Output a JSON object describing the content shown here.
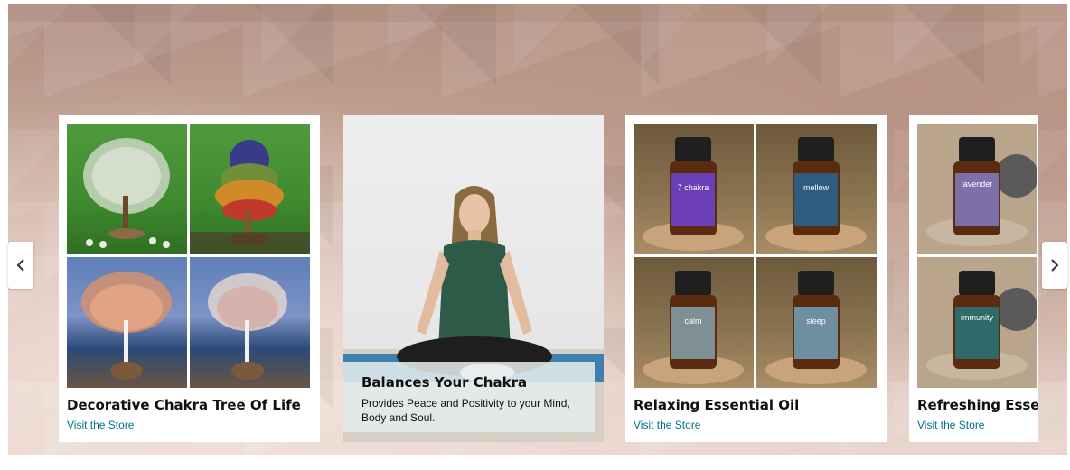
{
  "carousel": {
    "cards": [
      {
        "title": "Decorative Chakra Tree Of Life",
        "link": "Visit the Store"
      },
      {
        "title": "Balances Your Chakra",
        "description": "Provides Peace and Positivity to your Mind, Body and Soul."
      },
      {
        "title": "Relaxing Essential Oil",
        "link": "Visit the Store"
      },
      {
        "title": "Refreshing Essentia",
        "link": "Visit the Store"
      }
    ],
    "oil_labels": [
      "7 chakra",
      "mellow",
      "calm",
      "sleep",
      "lavender",
      "immunity"
    ],
    "nav": {
      "prev_icon": "chevron-left-icon",
      "next_icon": "chevron-right-icon"
    }
  },
  "colors": {
    "link": "#007185",
    "text": "#0f1111",
    "card_bg": "#ffffff"
  }
}
